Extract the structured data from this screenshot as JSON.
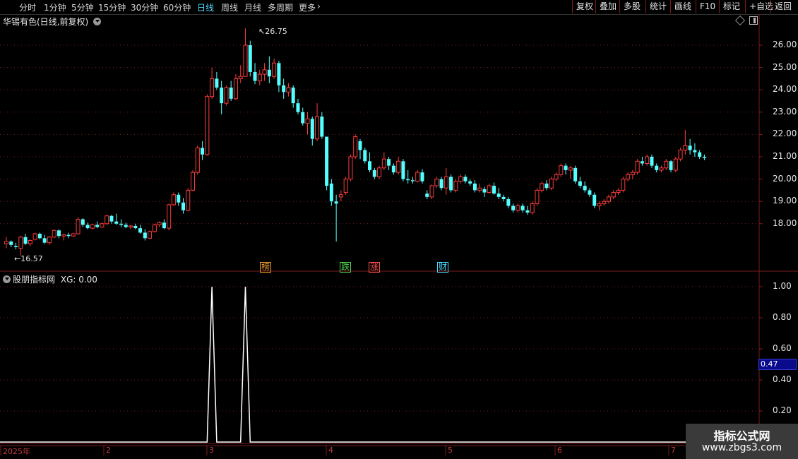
{
  "toolbar": {
    "periods": [
      {
        "label": "分时",
        "active": false
      },
      {
        "label": "1分钟",
        "active": false
      },
      {
        "label": "5分钟",
        "active": false
      },
      {
        "label": "15分钟",
        "active": false
      },
      {
        "label": "30分钟",
        "active": false
      },
      {
        "label": "60分钟",
        "active": false
      },
      {
        "label": "日线",
        "active": true
      },
      {
        "label": "周线",
        "active": false
      },
      {
        "label": "月线",
        "active": false
      },
      {
        "label": "多周期",
        "active": false
      },
      {
        "label": "更多",
        "active": false
      }
    ],
    "right": [
      "复权",
      "叠加",
      "多股",
      "统计",
      "画线",
      "F10",
      "+自选",
      "返回"
    ],
    "mark_label": "标记"
  },
  "stock_title": "华锡有色(日线,前复权)",
  "indicator_title": "股朋指标网",
  "indicator_value": "XG: 0.00",
  "high_label": "26.75",
  "low_label": "16.57",
  "price_axis": [
    "26.00",
    "25.00",
    "24.00",
    "23.00",
    "22.00",
    "21.00",
    "20.00",
    "19.00",
    "18.00"
  ],
  "indicator_axis": [
    "1.00",
    "0.80",
    "0.60",
    "0.40",
    "0.20"
  ],
  "indicator_cursor": "0.47",
  "event_markers": [
    {
      "label": "榜",
      "color": "#f0a028"
    },
    {
      "label": "跌",
      "color": "#4fd14f"
    },
    {
      "label": "涨",
      "color": "#ff5050"
    },
    {
      "label": "财",
      "color": "#4fd9ff"
    }
  ],
  "date_axis": [
    "2025年",
    "2",
    "3",
    "4",
    "5",
    "6",
    "7"
  ],
  "watermark": {
    "line1": "指标公式网",
    "line2": "www.zbgs3.com"
  },
  "colors": {
    "up": "#ff3c3c",
    "down": "#54ffff",
    "grid": "#7a1d1d",
    "signal": "#ffffff"
  },
  "chart_data": [
    {
      "type": "candlestick",
      "title": "华锡有色(日线,前复权)",
      "ylim": [
        17.0,
        26.9
      ],
      "high": 26.75,
      "low": 16.57,
      "candles": [
        [
          17.1,
          17.4,
          16.9,
          17.2
        ],
        [
          17.2,
          17.25,
          16.95,
          17.05
        ],
        [
          17.0,
          17.15,
          16.85,
          16.95
        ],
        [
          16.9,
          17.45,
          16.57,
          17.4
        ],
        [
          17.4,
          17.55,
          17.05,
          17.1
        ],
        [
          17.1,
          17.3,
          17.0,
          17.25
        ],
        [
          17.3,
          17.6,
          17.25,
          17.55
        ],
        [
          17.55,
          17.6,
          17.3,
          17.35
        ],
        [
          17.35,
          17.5,
          17.1,
          17.15
        ],
        [
          17.15,
          17.45,
          17.05,
          17.4
        ],
        [
          17.4,
          17.75,
          17.35,
          17.7
        ],
        [
          17.7,
          17.75,
          17.35,
          17.45
        ],
        [
          17.45,
          17.55,
          17.25,
          17.5
        ],
        [
          17.5,
          17.6,
          17.35,
          17.45
        ],
        [
          17.45,
          17.6,
          17.4,
          17.55
        ],
        [
          17.55,
          18.3,
          17.5,
          18.2
        ],
        [
          18.2,
          18.25,
          17.85,
          17.95
        ],
        [
          17.95,
          18.05,
          17.75,
          17.8
        ],
        [
          17.8,
          18.0,
          17.75,
          17.95
        ],
        [
          17.95,
          18.1,
          17.8,
          17.85
        ],
        [
          17.85,
          18.05,
          17.8,
          18.0
        ],
        [
          18.0,
          18.4,
          17.95,
          18.35
        ],
        [
          18.35,
          18.4,
          18.0,
          18.1
        ],
        [
          18.1,
          18.45,
          17.95,
          18.0
        ],
        [
          18.0,
          18.2,
          17.85,
          17.95
        ],
        [
          17.95,
          18.05,
          17.8,
          17.85
        ],
        [
          17.85,
          17.95,
          17.75,
          17.9
        ],
        [
          17.9,
          18.0,
          17.75,
          17.8
        ],
        [
          17.8,
          17.95,
          17.55,
          17.6
        ],
        [
          17.6,
          17.75,
          17.25,
          17.35
        ],
        [
          17.35,
          17.7,
          17.3,
          17.65
        ],
        [
          17.65,
          18.0,
          17.6,
          17.95
        ],
        [
          17.95,
          18.1,
          17.85,
          18.05
        ],
        [
          18.05,
          18.2,
          17.75,
          17.8
        ],
        [
          17.8,
          18.9,
          17.7,
          18.85
        ],
        [
          18.85,
          19.4,
          18.8,
          19.3
        ],
        [
          19.3,
          19.4,
          18.8,
          18.95
        ],
        [
          18.95,
          19.15,
          18.45,
          18.6
        ],
        [
          18.6,
          19.6,
          18.55,
          19.5
        ],
        [
          19.5,
          20.4,
          19.45,
          20.3
        ],
        [
          20.3,
          21.5,
          20.2,
          21.4
        ],
        [
          21.4,
          21.7,
          20.85,
          21.1
        ],
        [
          21.1,
          23.8,
          21.05,
          23.7
        ],
        [
          23.7,
          25.0,
          23.6,
          24.5
        ],
        [
          24.5,
          24.8,
          24.0,
          24.1
        ],
        [
          24.1,
          24.4,
          22.9,
          23.4
        ],
        [
          23.4,
          24.2,
          23.3,
          24.1
        ],
        [
          24.1,
          24.4,
          23.5,
          23.6
        ],
        [
          23.6,
          24.7,
          23.55,
          24.5
        ],
        [
          24.5,
          25.1,
          24.3,
          24.6
        ],
        [
          24.6,
          26.75,
          24.6,
          26.0
        ],
        [
          26.0,
          26.2,
          24.6,
          24.8
        ],
        [
          24.8,
          25.2,
          24.25,
          24.4
        ],
        [
          24.4,
          24.9,
          24.2,
          24.7
        ],
        [
          24.7,
          25.2,
          24.4,
          24.9
        ],
        [
          24.9,
          25.5,
          24.3,
          24.6
        ],
        [
          24.6,
          25.4,
          24.5,
          25.2
        ],
        [
          25.2,
          25.3,
          23.9,
          24.2
        ],
        [
          24.2,
          24.5,
          23.6,
          23.9
        ],
        [
          23.9,
          24.3,
          23.7,
          24.1
        ],
        [
          24.1,
          24.2,
          23.2,
          23.4
        ],
        [
          23.4,
          23.6,
          22.9,
          23.0
        ],
        [
          23.0,
          23.2,
          22.4,
          22.5
        ],
        [
          22.5,
          23.0,
          22.0,
          22.7
        ],
        [
          22.7,
          22.8,
          21.5,
          21.8
        ],
        [
          21.8,
          23.4,
          21.7,
          22.8
        ],
        [
          22.8,
          23.0,
          21.8,
          21.9
        ],
        [
          21.9,
          20.4,
          19.5,
          19.7
        ],
        [
          19.8,
          20.0,
          18.8,
          19.0
        ],
        [
          19.0,
          19.3,
          17.2,
          18.9
        ],
        [
          19.2,
          19.5,
          19.0,
          19.3
        ],
        [
          19.4,
          20.1,
          19.3,
          20.0
        ],
        [
          20.0,
          21.1,
          19.9,
          21.0
        ],
        [
          21.0,
          22.0,
          20.9,
          21.9
        ],
        [
          21.7,
          21.8,
          20.9,
          21.3
        ],
        [
          21.3,
          21.4,
          20.7,
          20.8
        ],
        [
          20.8,
          21.2,
          20.3,
          20.4
        ],
        [
          20.4,
          20.5,
          20.0,
          20.1
        ],
        [
          20.1,
          20.6,
          20.0,
          20.5
        ],
        [
          20.5,
          21.2,
          20.4,
          20.9
        ],
        [
          20.9,
          21.0,
          20.4,
          20.6
        ],
        [
          20.6,
          20.7,
          20.2,
          20.3
        ],
        [
          20.3,
          21.0,
          20.2,
          20.8
        ],
        [
          20.8,
          20.9,
          19.9,
          20.0
        ],
        [
          20.0,
          20.4,
          19.8,
          19.95
        ],
        [
          19.95,
          20.1,
          19.8,
          19.9
        ],
        [
          19.9,
          20.4,
          19.85,
          20.3
        ],
        [
          20.3,
          20.45,
          19.8,
          19.9
        ],
        [
          19.35,
          19.5,
          19.1,
          19.2
        ],
        [
          19.2,
          19.75,
          19.1,
          19.7
        ],
        [
          19.7,
          20.1,
          19.6,
          20.0
        ],
        [
          20.0,
          20.1,
          19.5,
          19.6
        ],
        [
          19.6,
          20.5,
          19.3,
          20.1
        ],
        [
          20.1,
          20.2,
          19.4,
          19.5
        ],
        [
          19.5,
          20.0,
          19.4,
          19.9
        ],
        [
          19.9,
          20.2,
          19.8,
          20.1
        ],
        [
          20.1,
          20.2,
          19.8,
          19.9
        ],
        [
          19.9,
          20.0,
          19.7,
          19.8
        ],
        [
          19.8,
          19.95,
          19.4,
          19.5
        ],
        [
          19.5,
          19.8,
          19.4,
          19.6
        ],
        [
          19.55,
          19.65,
          19.2,
          19.4
        ],
        [
          19.4,
          19.8,
          19.35,
          19.7
        ],
        [
          19.7,
          19.85,
          19.3,
          19.35
        ],
        [
          19.35,
          19.6,
          19.1,
          19.2
        ],
        [
          19.2,
          19.3,
          19.0,
          19.1
        ],
        [
          19.1,
          19.2,
          18.7,
          18.8
        ],
        [
          18.8,
          18.9,
          18.5,
          18.6
        ],
        [
          18.6,
          18.9,
          18.5,
          18.8
        ],
        [
          18.8,
          18.9,
          18.5,
          18.6
        ],
        [
          18.6,
          18.8,
          18.4,
          18.5
        ],
        [
          18.5,
          19.0,
          18.4,
          18.9
        ],
        [
          18.9,
          19.6,
          18.8,
          19.5
        ],
        [
          19.5,
          19.9,
          19.4,
          19.8
        ],
        [
          19.8,
          19.95,
          19.5,
          19.6
        ],
        [
          19.6,
          20.1,
          19.5,
          20.0
        ],
        [
          20.0,
          20.3,
          19.9,
          20.2
        ],
        [
          20.2,
          20.7,
          20.1,
          20.6
        ],
        [
          20.6,
          20.7,
          20.2,
          20.4
        ],
        [
          20.4,
          20.6,
          20.0,
          20.5
        ],
        [
          20.5,
          20.6,
          19.8,
          19.9
        ],
        [
          19.9,
          20.1,
          19.6,
          19.7
        ],
        [
          19.7,
          19.9,
          19.4,
          19.5
        ],
        [
          19.5,
          19.6,
          19.2,
          19.3
        ],
        [
          19.3,
          19.4,
          18.7,
          18.8
        ],
        [
          18.8,
          19.0,
          18.6,
          18.9
        ],
        [
          18.9,
          19.1,
          18.8,
          19.0
        ],
        [
          19.0,
          19.3,
          18.9,
          19.2
        ],
        [
          19.2,
          19.5,
          19.1,
          19.4
        ],
        [
          19.4,
          19.6,
          19.3,
          19.5
        ],
        [
          19.5,
          20.1,
          19.4,
          20.0
        ],
        [
          20.0,
          20.3,
          19.9,
          20.2
        ],
        [
          20.2,
          20.4,
          20.0,
          20.3
        ],
        [
          20.3,
          20.9,
          20.2,
          20.8
        ],
        [
          20.8,
          21.0,
          20.6,
          20.7
        ],
        [
          20.7,
          21.1,
          20.6,
          21.0
        ],
        [
          21.0,
          21.1,
          20.5,
          20.6
        ],
        [
          20.6,
          20.7,
          20.3,
          20.4
        ],
        [
          20.4,
          20.6,
          20.3,
          20.5
        ],
        [
          20.5,
          20.9,
          20.4,
          20.8
        ],
        [
          20.8,
          20.85,
          20.3,
          20.4
        ],
        [
          20.4,
          21.0,
          20.3,
          20.9
        ],
        [
          20.9,
          21.4,
          20.8,
          21.3
        ],
        [
          21.3,
          22.2,
          21.1,
          21.5
        ],
        [
          21.5,
          21.8,
          21.1,
          21.3
        ],
        [
          21.3,
          21.6,
          21.0,
          21.2
        ],
        [
          21.2,
          21.3,
          20.9,
          21.0
        ],
        [
          21.0,
          21.1,
          20.85,
          20.95
        ]
      ]
    },
    {
      "type": "line",
      "title": "股朋指标网",
      "series": [
        {
          "name": "XG",
          "values": [
            0,
            0,
            0,
            0,
            0,
            0,
            0,
            0,
            0,
            0,
            0,
            0,
            0,
            0,
            0,
            0,
            0,
            0,
            0,
            0,
            0,
            0,
            0,
            0,
            0,
            0,
            0,
            0,
            0,
            0,
            0,
            0,
            0,
            0,
            0,
            0,
            0,
            0,
            0,
            0,
            0,
            0,
            0,
            1,
            0,
            0,
            0,
            0,
            0,
            0,
            1,
            0,
            0,
            0,
            0,
            0,
            0,
            0,
            0,
            0,
            0,
            0,
            0,
            0,
            0,
            0,
            0,
            0,
            0,
            0,
            0,
            0,
            0,
            0,
            0,
            0,
            0,
            0,
            0,
            0,
            0,
            0,
            0,
            0,
            0,
            0,
            0,
            0,
            0,
            0,
            0,
            0,
            0,
            0,
            0,
            0,
            0,
            0,
            0,
            0,
            0,
            0,
            0,
            0,
            0,
            0,
            0,
            0,
            0,
            0,
            0,
            0,
            0,
            0,
            0,
            0,
            0,
            0,
            0,
            0,
            0,
            0,
            0,
            0,
            0,
            0,
            0,
            0,
            0,
            0,
            0,
            0,
            0,
            0,
            0,
            0,
            0,
            0,
            0,
            0,
            0,
            0,
            0,
            0,
            0,
            0,
            0,
            0,
            0,
            0,
            0,
            0
          ]
        }
      ],
      "ylim": [
        0,
        1.1
      ],
      "yticks": [
        0.2,
        0.4,
        0.6,
        0.8,
        1.0
      ]
    }
  ]
}
